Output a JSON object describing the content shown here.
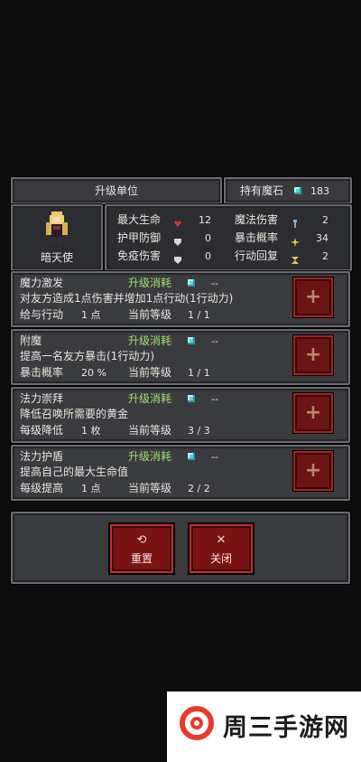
{
  "header": {
    "title": "升级单位",
    "owned_label": "持有魔石",
    "owned_count": "183"
  },
  "unit": {
    "name": "暗天使",
    "stats_left": [
      {
        "label": "最大生命",
        "value": "12",
        "icon": "heart-icon",
        "color": "#d83a3a"
      },
      {
        "label": "护甲防御",
        "value": "0",
        "icon": "shield-icon",
        "color": "#d8d8d8"
      },
      {
        "label": "免疫伤害",
        "value": "0",
        "icon": "shield-icon",
        "color": "#d8d8d8"
      }
    ],
    "stats_right": [
      {
        "label": "魔法伤害",
        "value": "2",
        "icon": "wand-icon",
        "color": "#6ac0e8"
      },
      {
        "label": "暴击概率",
        "value": "34",
        "icon": "burst-icon",
        "color": "#f0d040"
      },
      {
        "label": "行动回复",
        "value": "2",
        "icon": "hourglass-icon",
        "color": "#e8c060"
      }
    ]
  },
  "skills": [
    {
      "name": "魔力激发",
      "cost_label": "升级消耗",
      "cost_value": "--",
      "desc": "对友方造成1点伤害并增加1点行动(1行动力)",
      "stat_label": "给与行动",
      "stat_value": "1 点",
      "level_label": "当前等级",
      "level": "1 / 1"
    },
    {
      "name": "附魔",
      "cost_label": "升级消耗",
      "cost_value": "--",
      "desc": "提高一名友方暴击(1行动力)",
      "stat_label": "暴击概率",
      "stat_value": "20 %",
      "level_label": "当前等级",
      "level": "1 / 1"
    },
    {
      "name": "法力崇拜",
      "cost_label": "升级消耗",
      "cost_value": "--",
      "desc": "降低召唤所需要的黄金",
      "stat_label": "每级降低",
      "stat_value": "1 枚",
      "level_label": "当前等级",
      "level": "3 / 3"
    },
    {
      "name": "法力护盾",
      "cost_label": "升级消耗",
      "cost_value": "--",
      "desc": "提高自己的最大生命值",
      "stat_label": "每级提高",
      "stat_value": "1 点",
      "level_label": "当前等级",
      "level": "2 / 2"
    }
  ],
  "buttons": {
    "reset": "重置",
    "close": "关闭"
  },
  "watermark": {
    "text": "周三手游网"
  }
}
